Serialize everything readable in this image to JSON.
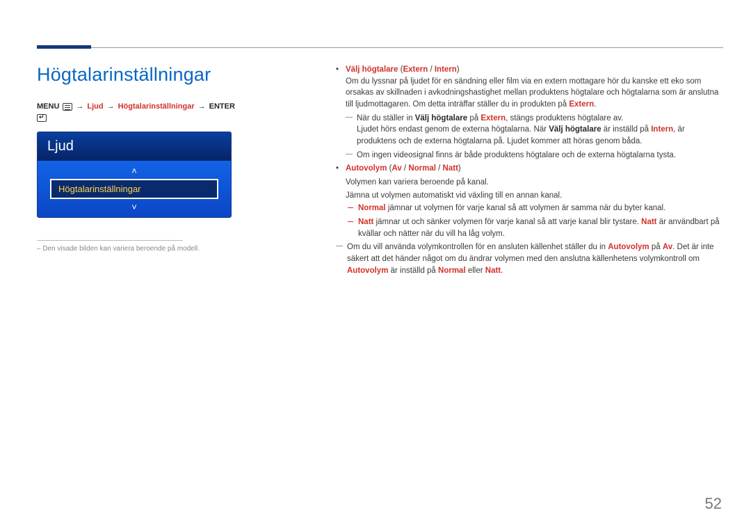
{
  "page_number": "52",
  "heading": "Högtalarinställningar",
  "breadcrumb": {
    "menu": "MENU",
    "arrow": "→",
    "ljud": "Ljud",
    "hogtalar": "Högtalarinställningar",
    "enter": "ENTER"
  },
  "tv": {
    "title": "Ljud",
    "item": "Högtalarinställningar"
  },
  "footnote": "Den visade bilden kan variera beroende på modell.",
  "r": {
    "opt1_label": "Välj högtalare",
    "opt1_paren_open": " (",
    "opt1_ext": "Extern",
    "opt1_sep": " / ",
    "opt1_int": "Intern",
    "opt1_paren_close": ")",
    "opt1_desc": "Om du lyssnar på ljudet för en sändning eller film via en extern mottagare hör du kanske ett eko som orsakas av skillnaden i avkodningshastighet mellan produktens högtalare och högtalarna som är anslutna till ljudmottagaren. Om detta inträffar ställer du in produkten på ",
    "opt1_desc_ext": "Extern",
    "opt1_desc_end": ".",
    "note1_a": "När du ställer in ",
    "note1_b": "Välj högtalare",
    "note1_c": " på ",
    "note1_d": "Extern",
    "note1_e": ", stängs produktens högtalare av.",
    "note1_line2_a": "Ljudet hörs endast genom de externa högtalarna. När ",
    "note1_line2_b": "Välj högtalare",
    "note1_line2_c": " är inställd på ",
    "note1_line2_d": "Intern",
    "note1_line2_e": ", är produktens och de externa högtalarna på. Ljudet kommer att höras genom båda.",
    "note2": "Om ingen videosignal finns är både produktens högtalare och de externa högtalarna tysta.",
    "opt2_label": "Autovolym",
    "opt2_paren_open": " (",
    "opt2_av": "Av",
    "opt2_sep1": " / ",
    "opt2_normal": "Normal",
    "opt2_sep2": " / ",
    "opt2_natt": "Natt",
    "opt2_paren_close": ")",
    "opt2_desc1": "Volymen kan variera beroende på kanal.",
    "opt2_desc2": "Jämna ut volymen automatiskt vid växling till en annan kanal.",
    "dash1_a": "Normal",
    "dash1_b": " jämnar ut volymen för varje kanal så att volymen är samma när du byter kanal.",
    "dash2_a": "Natt",
    "dash2_b": " jämnar ut och sänker volymen för varje kanal så att varje kanal blir tystare. ",
    "dash2_c": "Natt",
    "dash2_d": " är användbart på kvällar och nätter när du vill ha låg volym.",
    "note3_a": "Om du vill använda volymkontrollen för en ansluten källenhet ställer du in ",
    "note3_b": "Autovolym",
    "note3_c": " på ",
    "note3_d": "Av",
    "note3_e": ". Det är inte säkert att det händer något om du ändrar volymen med den anslutna källenhetens volymkontroll om ",
    "note3_f": "Autovolym",
    "note3_g": " är inställd på ",
    "note3_h": "Normal",
    "note3_i": " eller ",
    "note3_j": "Natt",
    "note3_k": "."
  }
}
